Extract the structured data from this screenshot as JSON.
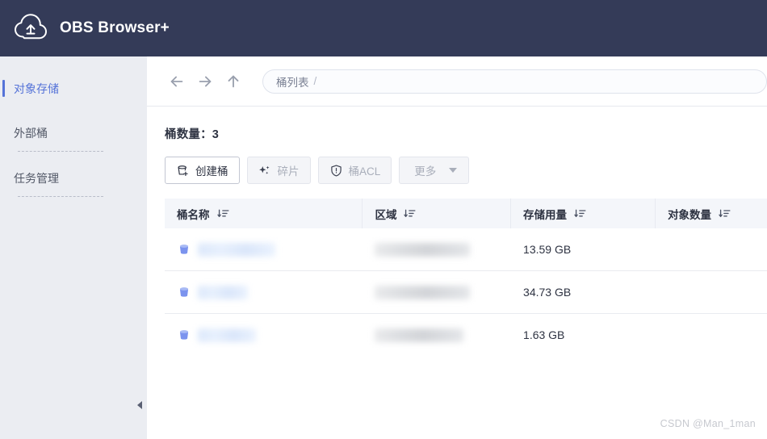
{
  "app": {
    "title": "OBS Browser+",
    "logo_icon": "cloud-upload-icon",
    "header_bg": "#343b58",
    "accent": "#5573d8"
  },
  "sidebar": {
    "items": [
      {
        "label": "对象存储",
        "active": true
      },
      {
        "label": "外部桶",
        "active": false
      },
      {
        "label": "任务管理",
        "active": false
      }
    ],
    "collapse_handle_icon": "chevron-left-icon"
  },
  "navbar": {
    "back_icon": "arrow-left-icon",
    "forward_icon": "arrow-right-icon",
    "up_icon": "arrow-up-icon",
    "address": {
      "crumb": "桶列表",
      "separator": "/"
    }
  },
  "content": {
    "bucket_count_label": "桶数量：3",
    "toolbar": [
      {
        "label": "创建桶",
        "icon": "bucket-plus-icon",
        "disabled": false
      },
      {
        "label": "碎片",
        "icon": "fragments-icon",
        "disabled": true
      },
      {
        "label": "桶ACL",
        "icon": "shield-icon",
        "disabled": true
      },
      {
        "label": "更多",
        "icon": "caret-down-icon",
        "disabled": true
      }
    ],
    "table": {
      "columns": [
        {
          "label": "桶名称",
          "sort_icon": "sort-descending-icon"
        },
        {
          "label": "区域",
          "sort_icon": "sort-descending-icon"
        },
        {
          "label": "存储用量",
          "sort_icon": "sort-descending-icon"
        },
        {
          "label": "对象数量",
          "sort_icon": "sort-descending-icon"
        }
      ],
      "rows": [
        {
          "icon": "bucket-icon",
          "name": "",
          "name_redacted": true,
          "name_width": 96,
          "region": "",
          "region_redacted": true,
          "region_width": 118,
          "usage": "13.59 GB",
          "count": ""
        },
        {
          "icon": "bucket-icon",
          "name": "",
          "name_redacted": true,
          "name_width": 62,
          "region": "",
          "region_redacted": true,
          "region_width": 118,
          "usage": "34.73 GB",
          "count": ""
        },
        {
          "icon": "bucket-icon",
          "name": "",
          "name_redacted": true,
          "name_width": 72,
          "region": "",
          "region_redacted": true,
          "region_width": 110,
          "usage": "1.63 GB",
          "count": ""
        }
      ]
    }
  },
  "watermark": {
    "text": "CSDN @Man_1man"
  }
}
